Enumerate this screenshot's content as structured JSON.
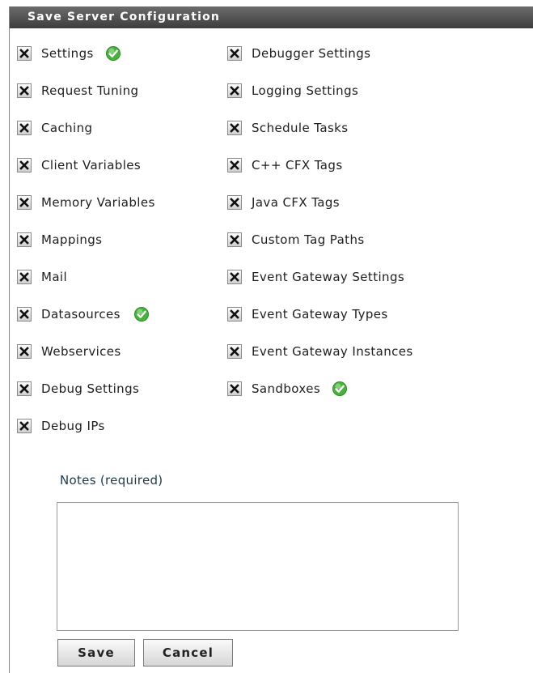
{
  "dialog": {
    "title": "Save Server Configuration"
  },
  "left_items": [
    {
      "label": "Settings",
      "checked": true,
      "status": "ok"
    },
    {
      "label": "Request Tuning",
      "checked": true
    },
    {
      "label": "Caching",
      "checked": true
    },
    {
      "label": "Client Variables",
      "checked": true
    },
    {
      "label": "Memory Variables",
      "checked": true
    },
    {
      "label": "Mappings",
      "checked": true
    },
    {
      "label": "Mail",
      "checked": true
    },
    {
      "label": "Datasources",
      "checked": true,
      "status": "ok"
    },
    {
      "label": "Webservices",
      "checked": true
    },
    {
      "label": "Debug Settings",
      "checked": true
    },
    {
      "label": "Debug IPs",
      "checked": true
    }
  ],
  "right_items": [
    {
      "label": "Debugger Settings",
      "checked": true
    },
    {
      "label": "Logging Settings",
      "checked": true
    },
    {
      "label": "Schedule Tasks",
      "checked": true
    },
    {
      "label": "C++ CFX Tags",
      "checked": true
    },
    {
      "label": "Java CFX Tags",
      "checked": true
    },
    {
      "label": "Custom Tag Paths",
      "checked": true
    },
    {
      "label": "Event Gateway Settings",
      "checked": true
    },
    {
      "label": "Event Gateway Types",
      "checked": true
    },
    {
      "label": "Event Gateway Instances",
      "checked": true
    },
    {
      "label": "Sandboxes",
      "checked": true,
      "status": "ok"
    }
  ],
  "notes": {
    "label": "Notes (required)",
    "value": ""
  },
  "buttons": {
    "save_label": "Save",
    "cancel_label": "Cancel"
  },
  "icons": {
    "checkbox": "x-checkbox-icon",
    "status_ok": "green-check-icon"
  },
  "colors": {
    "title_bar": "#4a4a4a",
    "ok_green": "#46b43a",
    "notes_label": "#1c3a4e"
  }
}
